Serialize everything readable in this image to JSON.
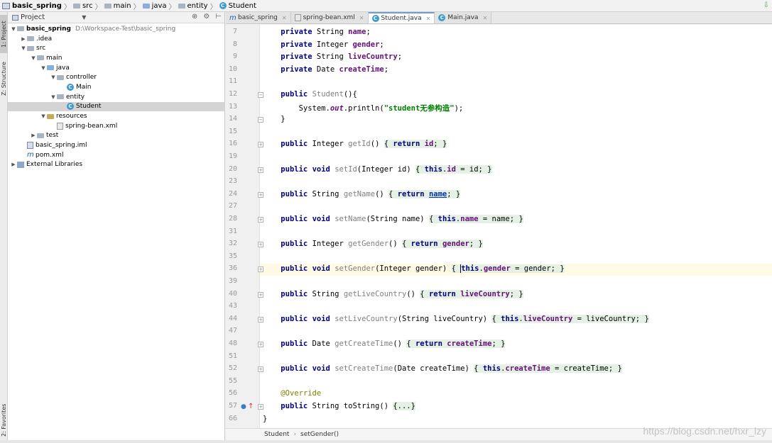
{
  "breadcrumb": [
    {
      "label": "basic_spring",
      "icon": "project-icon"
    },
    {
      "label": "src",
      "icon": "folder-icon"
    },
    {
      "label": "main",
      "icon": "folder-icon"
    },
    {
      "label": "java",
      "icon": "folder-icon"
    },
    {
      "label": "entity",
      "icon": "package-icon"
    },
    {
      "label": "Student",
      "icon": "class-icon"
    }
  ],
  "toolstripe": {
    "project": "1: Project",
    "structure": "Z: Structure",
    "favorites": "2: Favorites"
  },
  "project_panel": {
    "title": "Project",
    "tree": [
      {
        "label": "basic_spring",
        "path": "D:\\Workspace-Test\\basic_spring",
        "icon": "module-icon"
      },
      {
        "label": ".idea",
        "icon": "folder-icon"
      },
      {
        "label": "src",
        "icon": "folder-icon"
      },
      {
        "label": "main",
        "icon": "folder-icon"
      },
      {
        "label": "java",
        "icon": "source-folder-icon"
      },
      {
        "label": "controller",
        "icon": "package-icon"
      },
      {
        "label": "Main",
        "icon": "class-icon"
      },
      {
        "label": "entity",
        "icon": "package-icon"
      },
      {
        "label": "Student",
        "icon": "class-icon"
      },
      {
        "label": "resources",
        "icon": "resources-folder-icon"
      },
      {
        "label": "spring-bean.xml",
        "icon": "xml-file-icon"
      },
      {
        "label": "test",
        "icon": "folder-icon"
      },
      {
        "label": "basic_spring.iml",
        "icon": "iml-file-icon"
      },
      {
        "label": "pom.xml",
        "icon": "maven-icon"
      },
      {
        "label": "External Libraries",
        "icon": "library-icon"
      }
    ]
  },
  "tabs": [
    {
      "label": "basic_spring",
      "icon": "maven-icon"
    },
    {
      "label": "spring-bean.xml",
      "icon": "xml-file-icon"
    },
    {
      "label": "Student.java",
      "icon": "class-icon",
      "active": true
    },
    {
      "label": "Main.java",
      "icon": "class-icon"
    }
  ],
  "editor": {
    "lines": [
      {
        "n": "7",
        "text": "    private String name;"
      },
      {
        "n": "8",
        "text": "    private Integer gender;"
      },
      {
        "n": "9",
        "text": "    private String liveCountry;"
      },
      {
        "n": "10",
        "text": "    private Date createTime;"
      },
      {
        "n": "11",
        "text": ""
      },
      {
        "n": "12",
        "text": "    public Student(){"
      },
      {
        "n": "13",
        "text": "        System.out.println(\"student无参构造\");"
      },
      {
        "n": "14",
        "text": "    }"
      },
      {
        "n": "15",
        "text": ""
      },
      {
        "n": "16",
        "text": "    public Integer getId() { return id; }"
      },
      {
        "n": "19",
        "text": ""
      },
      {
        "n": "20",
        "text": "    public void setId(Integer id) { this.id = id; }"
      },
      {
        "n": "23",
        "text": ""
      },
      {
        "n": "24",
        "text": "    public String getName() { return name; }"
      },
      {
        "n": "27",
        "text": ""
      },
      {
        "n": "28",
        "text": "    public void setName(String name) { this.name = name; }"
      },
      {
        "n": "31",
        "text": ""
      },
      {
        "n": "32",
        "text": "    public Integer getGender() { return gender; }"
      },
      {
        "n": "35",
        "text": ""
      },
      {
        "n": "36",
        "text": "    public void setGender(Integer gender) { this.gender = gender; }"
      },
      {
        "n": "39",
        "text": ""
      },
      {
        "n": "40",
        "text": "    public String getLiveCountry() { return liveCountry; }"
      },
      {
        "n": "43",
        "text": ""
      },
      {
        "n": "44",
        "text": "    public void setLiveCountry(String liveCountry) { this.liveCountry = liveCountry; }"
      },
      {
        "n": "47",
        "text": ""
      },
      {
        "n": "48",
        "text": "    public Date getCreateTime() { return createTime; }"
      },
      {
        "n": "51",
        "text": ""
      },
      {
        "n": "52",
        "text": "    public void setCreateTime(Date createTime) { this.createTime = createTime; }"
      },
      {
        "n": "55",
        "text": ""
      },
      {
        "n": "56",
        "text": "    @Override"
      },
      {
        "n": "57",
        "text": "    public String toString() {...}"
      },
      {
        "n": "66",
        "text": "}"
      }
    ]
  },
  "editor_status": {
    "class": "Student",
    "method": "setGender()"
  },
  "watermark": "https://blog.csdn.net/hxr_lzy"
}
